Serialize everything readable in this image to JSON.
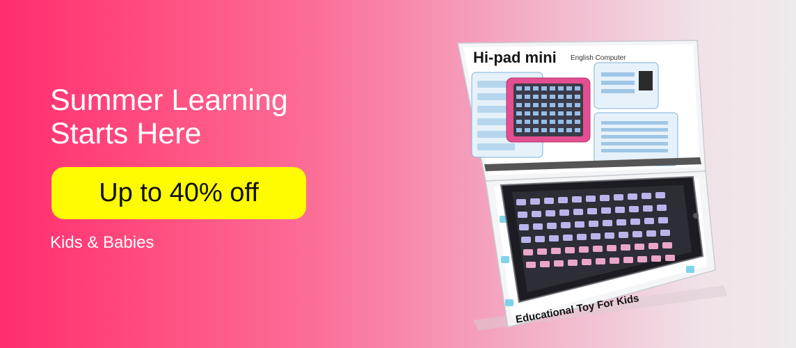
{
  "banner": {
    "headline": [
      "Summer Learning",
      "Starts Here"
    ],
    "offer_label": "Up to 40% off",
    "category_label": "Kids & Babies"
  },
  "product": {
    "brand": "Hi-pad mini",
    "subtitle": "English Computer",
    "tagline": "Educational Toy For Kids"
  },
  "colors": {
    "gradient_start": "#ff2d6e",
    "gradient_end": "#efeaec",
    "offer_background": "#fffb00",
    "text": "#ffffff"
  }
}
